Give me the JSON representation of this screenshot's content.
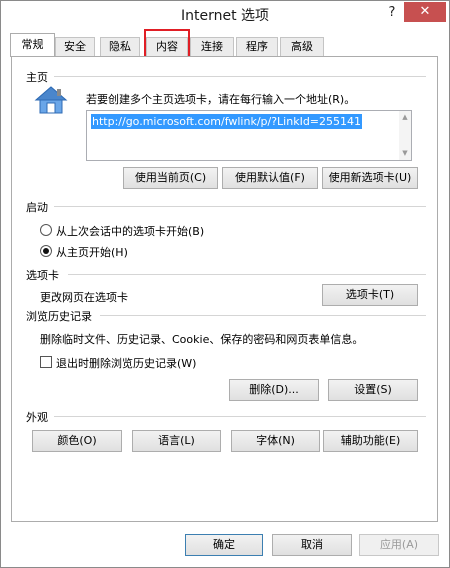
{
  "window": {
    "title": "Internet 选项",
    "help_label": "?",
    "close_label": "✕"
  },
  "tabs": [
    {
      "label": "常规",
      "active": true
    },
    {
      "label": "安全",
      "active": false
    },
    {
      "label": "隐私",
      "active": false
    },
    {
      "label": "内容",
      "active": false,
      "highlighted": true
    },
    {
      "label": "连接",
      "active": false
    },
    {
      "label": "程序",
      "active": false
    },
    {
      "label": "高级",
      "active": false
    }
  ],
  "homepage": {
    "section_title": "主页",
    "icon": "house-icon",
    "description": "若要创建多个主页选项卡，请在每行输入一个地址(R)。",
    "url_value": "http://go.microsoft.com/fwlink/p/?LinkId=255141",
    "buttons": {
      "use_current": "使用当前页(C)",
      "use_default": "使用默认值(F)",
      "use_new_tab": "使用新选项卡(U)"
    }
  },
  "startup": {
    "section_title": "启动",
    "option_last_session": "从上次会话中的选项卡开始(B)",
    "option_home_page": "从主页开始(H)",
    "selected": "option_home_page"
  },
  "tabs_section": {
    "section_title": "选项卡",
    "description": "更改网页在选项卡",
    "button": "选项卡(T)"
  },
  "history": {
    "section_title": "浏览历史记录",
    "description": "删除临时文件、历史记录、Cookie、保存的密码和网页表单信息。",
    "checkbox_label": "退出时删除浏览历史记录(W)",
    "checkbox_checked": false,
    "buttons": {
      "delete": "删除(D)...",
      "settings": "设置(S)"
    }
  },
  "appearance": {
    "section_title": "外观",
    "buttons": {
      "colors": "颜色(O)",
      "languages": "语言(L)",
      "fonts": "字体(N)",
      "accessibility": "辅助功能(E)"
    }
  },
  "footer": {
    "ok": "确定",
    "cancel": "取消",
    "apply": "应用(A)"
  },
  "colors": {
    "close_button": "#c75050",
    "selection": "#3399ff",
    "highlight_box": "#e01e25"
  }
}
